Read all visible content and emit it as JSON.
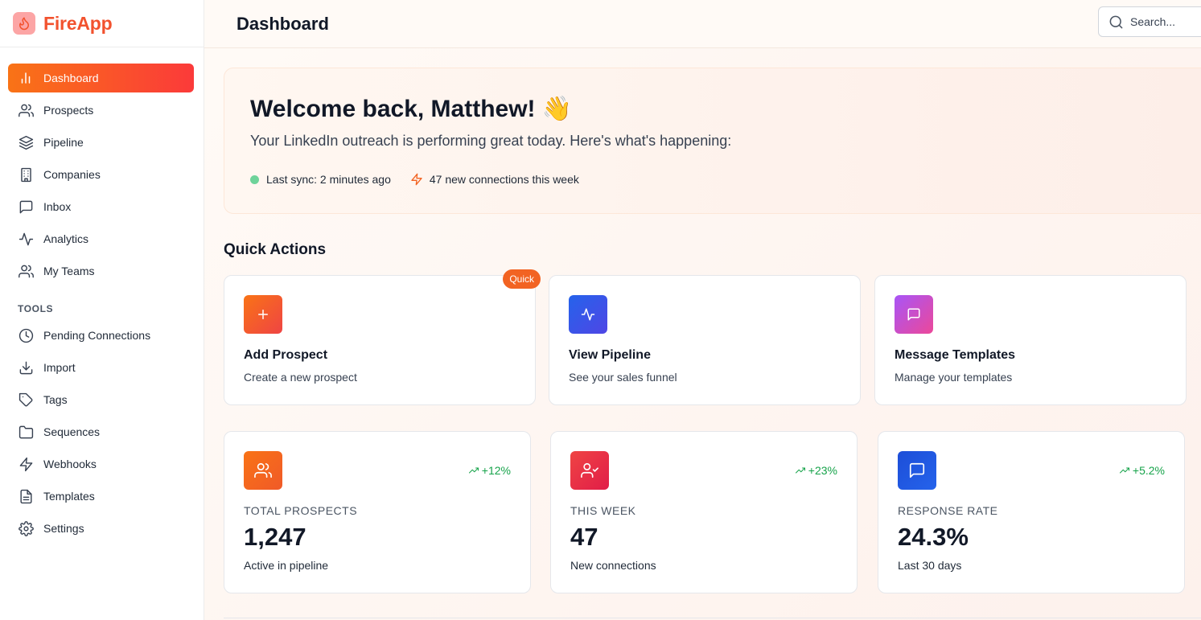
{
  "app": {
    "name": "FireApp",
    "logo_icon": "flame-icon"
  },
  "sidebar": {
    "items": [
      {
        "label": "Dashboard",
        "icon": "bar-chart-icon",
        "active": true
      },
      {
        "label": "Prospects",
        "icon": "users-icon"
      },
      {
        "label": "Pipeline",
        "icon": "layers-icon"
      },
      {
        "label": "Companies",
        "icon": "building-icon"
      },
      {
        "label": "Inbox",
        "icon": "message-square-icon"
      },
      {
        "label": "Analytics",
        "icon": "activity-icon"
      },
      {
        "label": "My Teams",
        "icon": "users-icon"
      }
    ],
    "tools_heading": "TOOLS",
    "tools": [
      {
        "label": "Pending Connections",
        "icon": "clock-icon"
      },
      {
        "label": "Import",
        "icon": "download-icon"
      },
      {
        "label": "Tags",
        "icon": "tag-icon"
      },
      {
        "label": "Sequences",
        "icon": "folder-icon"
      },
      {
        "label": "Webhooks",
        "icon": "zap-icon"
      },
      {
        "label": "Templates",
        "icon": "file-text-icon"
      },
      {
        "label": "Settings",
        "icon": "gear-icon"
      }
    ]
  },
  "header": {
    "title": "Dashboard",
    "search_placeholder": "Search..."
  },
  "welcome": {
    "title": "Welcome back, Matthew! 👋",
    "subtitle": "Your LinkedIn outreach is performing great today. Here's what's happening:",
    "sync_status": "Last sync: 2 minutes ago",
    "connections_note": "47 new connections this week"
  },
  "quick_actions": {
    "title": "Quick Actions",
    "badge": "Quick",
    "items": [
      {
        "name": "Add Prospect",
        "desc": "Create a new prospect",
        "icon": "plus-icon"
      },
      {
        "name": "View Pipeline",
        "desc": "See your sales funnel",
        "icon": "activity-icon"
      },
      {
        "name": "Message Templates",
        "desc": "Manage your templates",
        "icon": "message-square-icon"
      }
    ]
  },
  "stats": [
    {
      "label": "TOTAL PROSPECTS",
      "value": "1,247",
      "desc": "Active in pipeline",
      "trend": "+12%",
      "icon": "users-icon"
    },
    {
      "label": "THIS WEEK",
      "value": "47",
      "desc": "New connections",
      "trend": "+23%",
      "icon": "user-check-icon"
    },
    {
      "label": "RESPONSE RATE",
      "value": "24.3%",
      "desc": "Last 30 days",
      "trend": "+5.2%",
      "icon": "message-square-icon"
    }
  ],
  "colors": {
    "brand": "#f2522e",
    "active_gradient_start": "#f97316",
    "active_gradient_end": "#fb3a3a",
    "trend_positive": "#16a34a",
    "sync_dot": "#6ed39a"
  }
}
